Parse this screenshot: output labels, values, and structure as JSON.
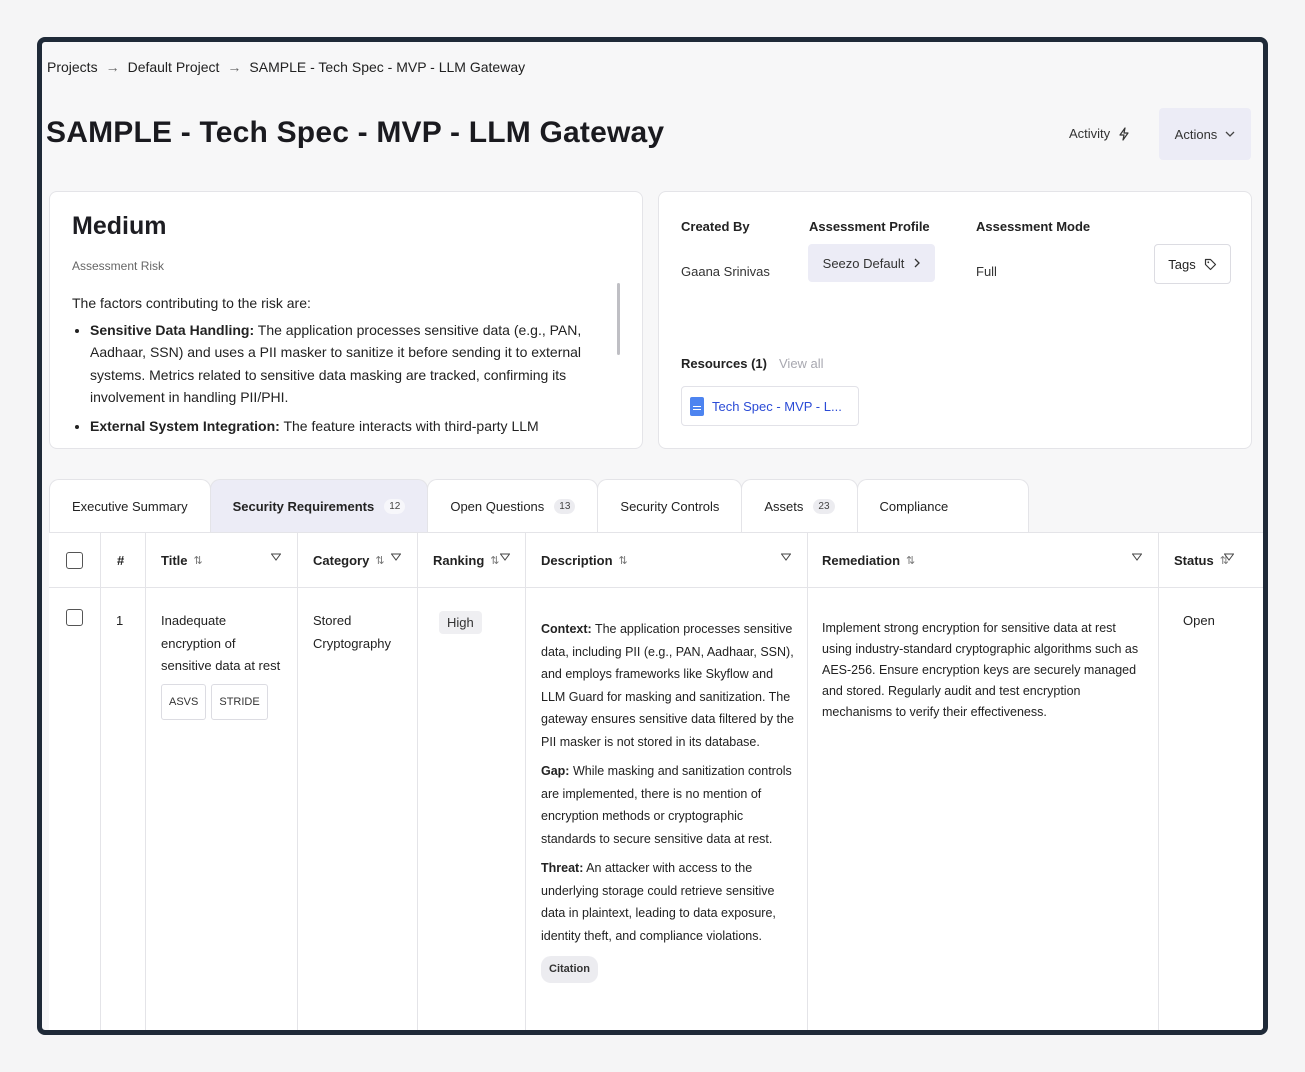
{
  "breadcrumb": {
    "items": [
      "Projects",
      "Default Project",
      "SAMPLE - Tech Spec - MVP - LLM Gateway"
    ],
    "separator": "→"
  },
  "page": {
    "title": "SAMPLE - Tech Spec - MVP - LLM Gateway",
    "activity_label": "Activity",
    "actions_label": "Actions"
  },
  "risk": {
    "level": "Medium",
    "sub_label": "Assessment Risk",
    "intro": "The factors contributing to the risk are:",
    "factors": [
      {
        "title": "Sensitive Data Handling:",
        "text": " The application processes sensitive data (e.g., PAN, Aadhaar, SSN) and uses a PII masker to sanitize it before sending it to external systems. Metrics related to sensitive data masking are tracked, confirming its involvement in handling PII/PHI."
      },
      {
        "title": "External System Integration:",
        "text": " The feature interacts with third-party LLM"
      }
    ]
  },
  "meta": {
    "created_by_label": "Created By",
    "created_by": "Gaana Srinivas",
    "profile_label": "Assessment Profile",
    "profile": "Seezo Default",
    "mode_label": "Assessment Mode",
    "mode": "Full",
    "tags_label": "Tags",
    "resources_label": "Resources (1)",
    "view_all": "View all",
    "resource_name": "Tech Spec - MVP - L..."
  },
  "tabs": [
    {
      "label": "Executive Summary",
      "count": ""
    },
    {
      "label": "Security Requirements",
      "count": "12"
    },
    {
      "label": "Open Questions",
      "count": "13"
    },
    {
      "label": "Security Controls",
      "count": ""
    },
    {
      "label": "Assets",
      "count": "23"
    },
    {
      "label": "Compliance",
      "count": ""
    }
  ],
  "table": {
    "headers": {
      "num": "#",
      "title": "Title",
      "category": "Category",
      "ranking": "Ranking",
      "description": "Description",
      "remediation": "Remediation",
      "status": "Status"
    },
    "rows": [
      {
        "num": "1",
        "title": "Inadequate encryption of sensitive data at rest",
        "tags": [
          "ASVS",
          "STRIDE"
        ],
        "category": "Stored Cryptography",
        "ranking": "High",
        "context_label": "Context:",
        "context": " The application processes sensitive data, including PII (e.g., PAN, Aadhaar, SSN), and employs frameworks like Skyflow and LLM Guard for masking and sanitization. The gateway ensures sensitive data filtered by the PII masker is not stored in its database.",
        "gap_label": "Gap:",
        "gap": " While masking and sanitization controls are implemented, there is no mention of encryption methods or cryptographic standards to secure sensitive data at rest.",
        "threat_label": "Threat:",
        "threat": " An attacker with access to the underlying storage could retrieve sensitive data in plaintext, leading to data exposure, identity theft, and compliance violations.",
        "citation": "Citation",
        "remediation": "Implement strong encryption for sensitive data at rest using industry-standard cryptographic algorithms such as AES-256. Ensure encryption keys are securely managed and stored. Regularly audit and test encryption mechanisms to verify their effectiveness.",
        "status": "Open"
      }
    ]
  }
}
